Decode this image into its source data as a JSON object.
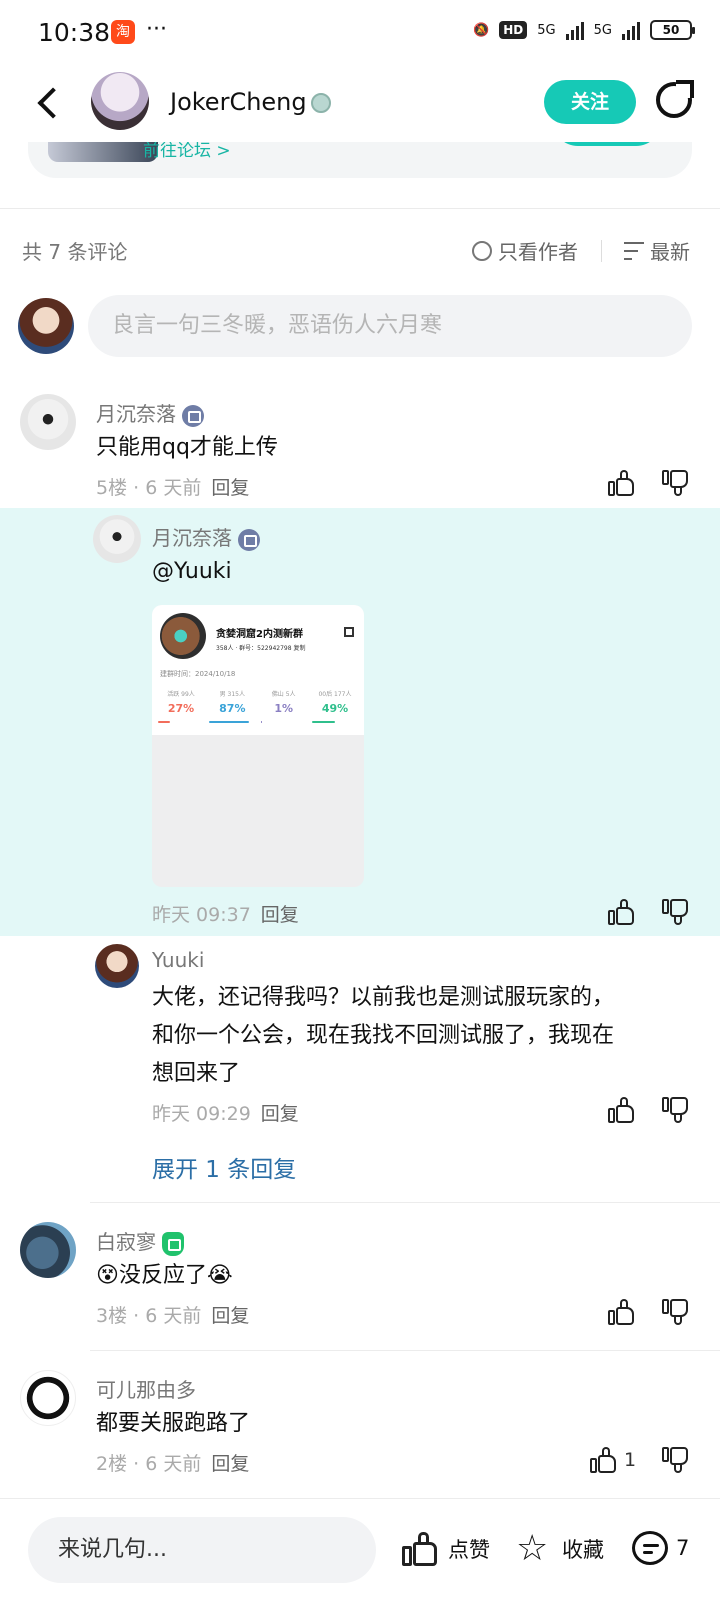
{
  "status_bar": {
    "time": "10:38",
    "app_icon_label": "淘",
    "more": "···",
    "network_label": "HD",
    "signal1": "5G",
    "signal2": "5G",
    "battery": "50"
  },
  "header": {
    "username": "JokerCheng",
    "follow_label": "关注",
    "icons": [
      "back-icon",
      "avatar",
      "share-icon"
    ]
  },
  "forum": {
    "link_label": "前往论坛 >"
  },
  "comments_header": {
    "count_label": "共 7 条评论",
    "only_author_label": "只看作者",
    "sort_label": "最新"
  },
  "compose": {
    "placeholder": "良言一句三冬暖，恶语伤人六月寒"
  },
  "comments": [
    {
      "user": "月沉奈落",
      "text": "只能用qq才能上传",
      "floor_time": "5楼 · 6 天前",
      "reply_label": "回复"
    },
    {
      "user": "月沉奈落",
      "text": "@Yuuki",
      "time": "昨天 09:37",
      "reply_label": "回复",
      "image": {
        "group_name": "贪婪洞窟2内测新群",
        "group_sub": "358人 · 群号：522942798  复制",
        "date": "建群时间：2024/10/18",
        "stats": [
          {
            "label": "活跃 99人",
            "value": "27%",
            "color": "#f26d5b"
          },
          {
            "label": "男 315人",
            "value": "87%",
            "color": "#3aa3d8"
          },
          {
            "label": "佛山 5人",
            "value": "1%",
            "color": "#8a7fc2"
          },
          {
            "label": "00后 177人",
            "value": "49%",
            "color": "#2fbf8c"
          }
        ]
      }
    },
    {
      "user": "Yuuki",
      "text_lines": [
        "大佬，还记得我吗？以前我也是测试服玩家的，",
        "和你一个公会，现在我找不回测试服了，我现在",
        "想回来了"
      ],
      "time": "昨天 09:29",
      "reply_label": "回复"
    },
    {
      "expand_label": "展开 1 条回复"
    },
    {
      "user": "白寂寥",
      "text": "没反应了",
      "emoji_prefix": "😵",
      "emoji_suffix": "😭",
      "floor_time": "3楼 · 6 天前",
      "reply_label": "回复"
    },
    {
      "user": "可儿那由多",
      "text": "都要关服跑路了",
      "floor_time": "2楼 · 6 天前",
      "reply_label": "回复",
      "likes": "1"
    }
  ],
  "bottom_bar": {
    "input_placeholder": "来说几句...",
    "like_label": "点赞",
    "fav_label": "收藏",
    "comment_count": "7"
  },
  "colors": {
    "accent": "#16c9b6",
    "highlight_bg": "#e3f8f7",
    "link_blue": "#2b6ea6"
  }
}
